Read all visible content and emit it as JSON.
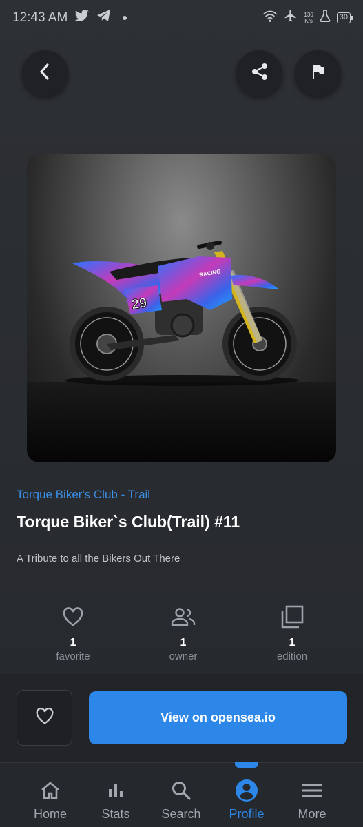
{
  "status_bar": {
    "time": "12:43 AM",
    "net_speed_value": "136",
    "net_speed_unit": "K/s",
    "battery": "30",
    "icons": [
      "twitter-icon",
      "telegram-icon",
      "dot-icon",
      "wifi-icon",
      "airplane-icon",
      "flask-icon",
      "battery-icon"
    ]
  },
  "header": {
    "buttons": [
      "back-arrow-icon",
      "share-icon",
      "flag-icon"
    ]
  },
  "nft": {
    "collection": "Torque Biker's Club - Trail",
    "title": "Torque Biker`s Club(Trail) #11",
    "description": "A Tribute to all the Bikers Out There",
    "bike_number": "29",
    "bike_brand": "RACING"
  },
  "stats": [
    {
      "icon": "heart-outline-icon",
      "count": "1",
      "label": "favorite"
    },
    {
      "icon": "people-icon",
      "count": "1",
      "label": "owner"
    },
    {
      "icon": "collection-icon",
      "count": "1",
      "label": "edition"
    }
  ],
  "actions": {
    "favorite_icon": "heart-outline-icon",
    "view_label": "View on opensea.io",
    "accent_color": "#2d87e8"
  },
  "nav": {
    "active": "Profile",
    "items": [
      {
        "label": "Home",
        "icon": "home-icon"
      },
      {
        "label": "Stats",
        "icon": "stats-icon"
      },
      {
        "label": "Search",
        "icon": "search-icon"
      },
      {
        "label": "Profile",
        "icon": "profile-icon"
      },
      {
        "label": "More",
        "icon": "menu-icon"
      }
    ]
  }
}
